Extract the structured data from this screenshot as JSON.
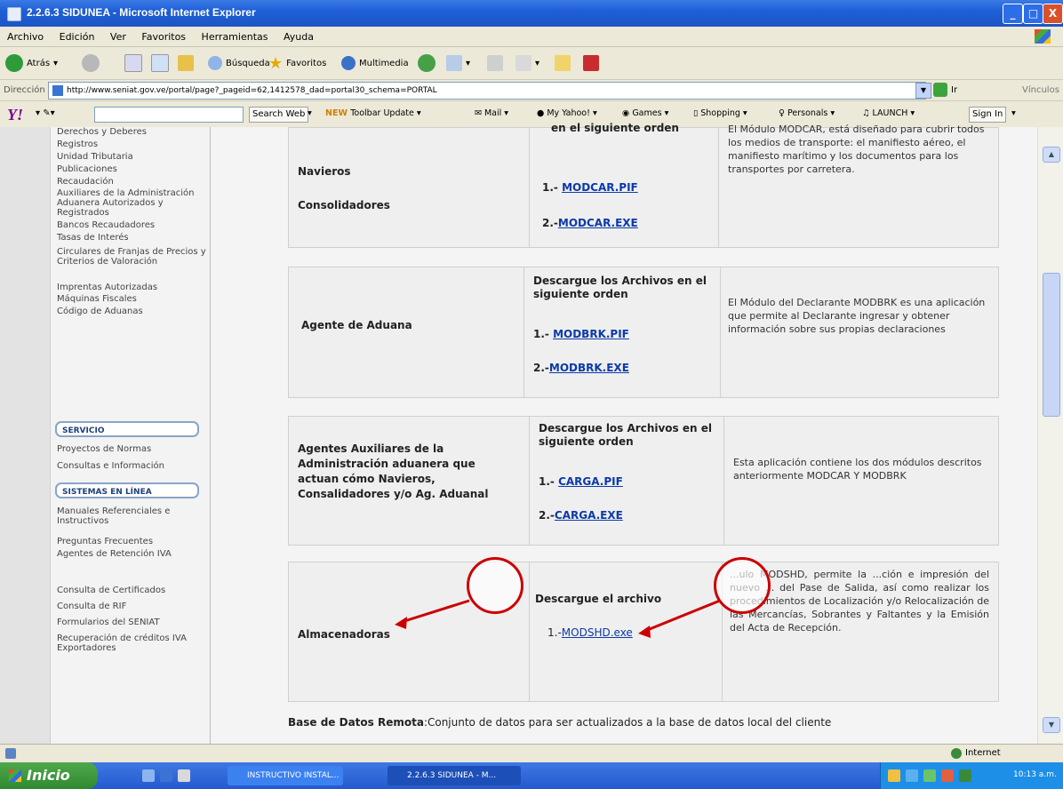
{
  "window": {
    "title": "2.2.6.3 SIDUNEA - Microsoft Internet Explorer",
    "min": "_",
    "max": "□",
    "close": "X"
  },
  "menu": [
    "Archivo",
    "Edición",
    "Ver",
    "Favoritos",
    "Herramientas",
    "Ayuda"
  ],
  "toolbar": {
    "back": "Atrás",
    "search": "Búsqueda",
    "favorites": "Favoritos",
    "multimedia": "Multimedia"
  },
  "address": {
    "label": "Dirección",
    "url": "http://www.seniat.gov.ve/portal/page?_pageid=62,1412578_dad=portal30_schema=PORTAL",
    "go": "Ir",
    "links": "Vínculos"
  },
  "yahoo": {
    "logo": "Y!",
    "search_web": "Search Web",
    "toolbar_update": "Toolbar Update",
    "mail": "Mail",
    "my_yahoo": "My Yahoo!",
    "games": "Games",
    "shopping": "Shopping",
    "personals": "Personals",
    "launch": "LAUNCH",
    "sign_in": "Sign In"
  },
  "sidebar": {
    "items_top": [
      "Derechos y Deberes",
      "Registros",
      "Unidad Tributaria",
      "Publicaciones",
      "Recaudación",
      "Auxiliares de la Administración Aduanera Autorizados y Registrados",
      "Bancos Recaudadores",
      "Tasas de Interés",
      "Circulares de Franjas de Precios y Criterios de Valoración",
      "Imprentas Autorizadas",
      "Máquinas Fiscales",
      "Código de Aduanas"
    ],
    "servicio": "SERVICIO",
    "items_servicio": [
      "Proyectos de Normas",
      "Consultas e Información"
    ],
    "sistemas": "SISTEMAS EN LÍNEA",
    "items_sistemas": [
      "Manuales Referenciales e Instructivos",
      "Preguntas Frecuentes",
      "Agentes de Retención IVA",
      "Consulta de Certificados",
      "Consulta de RIF",
      "Formularios del SENIAT",
      "Recuperación de créditos IVA Exportadores"
    ]
  },
  "tables": [
    {
      "roles": [
        "Navieros",
        "Consolidadores"
      ],
      "header": "en el siguiente orden",
      "links": [
        {
          "prefix": "1.- ",
          "label": "MODCAR.PIF"
        },
        {
          "prefix": "2.-",
          "label": "MODCAR.EXE"
        }
      ],
      "description": "El Módulo MODCAR, está diseñado para cubrir todos los medios de transporte: el manifiesto aéreo, el manifiesto marítimo y los documentos para los transportes por carretera."
    },
    {
      "roles": [
        "Agente de Aduana"
      ],
      "header": "Descargue los Archivos en el siguiente orden",
      "links": [
        {
          "prefix": "1.- ",
          "label": "MODBRK.PIF"
        },
        {
          "prefix": "2.-",
          "label": "MODBRK.EXE"
        }
      ],
      "description": "El Módulo del Declarante MODBRK es una aplicación que permite al Declarante ingresar y obtener información sobre sus propias declaraciones"
    },
    {
      "roles": [
        "Agentes Auxiliares de la Administración aduanera que actuan cómo Navieros, Consalidadores y/o Ag. Aduanal"
      ],
      "header": "Descargue los Archivos en el siguiente orden",
      "links": [
        {
          "prefix": "1.- ",
          "label": "CARGA.PIF"
        },
        {
          "prefix": "2.-",
          "label": "CARGA.EXE"
        }
      ],
      "description": "Esta aplicación contiene los dos módulos descritos anteriormente MODCAR Y MODBRK"
    },
    {
      "roles": [
        "Almacenadoras"
      ],
      "header": "Descargue el archivo",
      "links": [
        {
          "prefix": "1.-",
          "label": "MODSHD.exe"
        }
      ],
      "description": "...ulo MODSHD, permite la ...ción e impresión del nuevo ... del Pase de Salida, así como realizar los procedimientos de Localización y/o Relocalización de las Mercancías, Sobrantes y Faltantes y la Emisión del Acta de Recepción."
    }
  ],
  "bottom": {
    "bold": "Base de Datos Remota",
    "text": ":Conjunto de datos para ser actualizados a la base de datos local del cliente"
  },
  "status": {
    "zone": "Internet"
  },
  "taskbar": {
    "start": "Inicio",
    "tasks": [
      "INSTRUCTIVO INSTAL...",
      "2.2.6.3 SIDUNEA - M..."
    ],
    "clock": "10:13 a.m."
  },
  "colors": {
    "link": "#0b3aa8",
    "annotation": "#cc0000",
    "titlebar": "#1f5fd6"
  }
}
